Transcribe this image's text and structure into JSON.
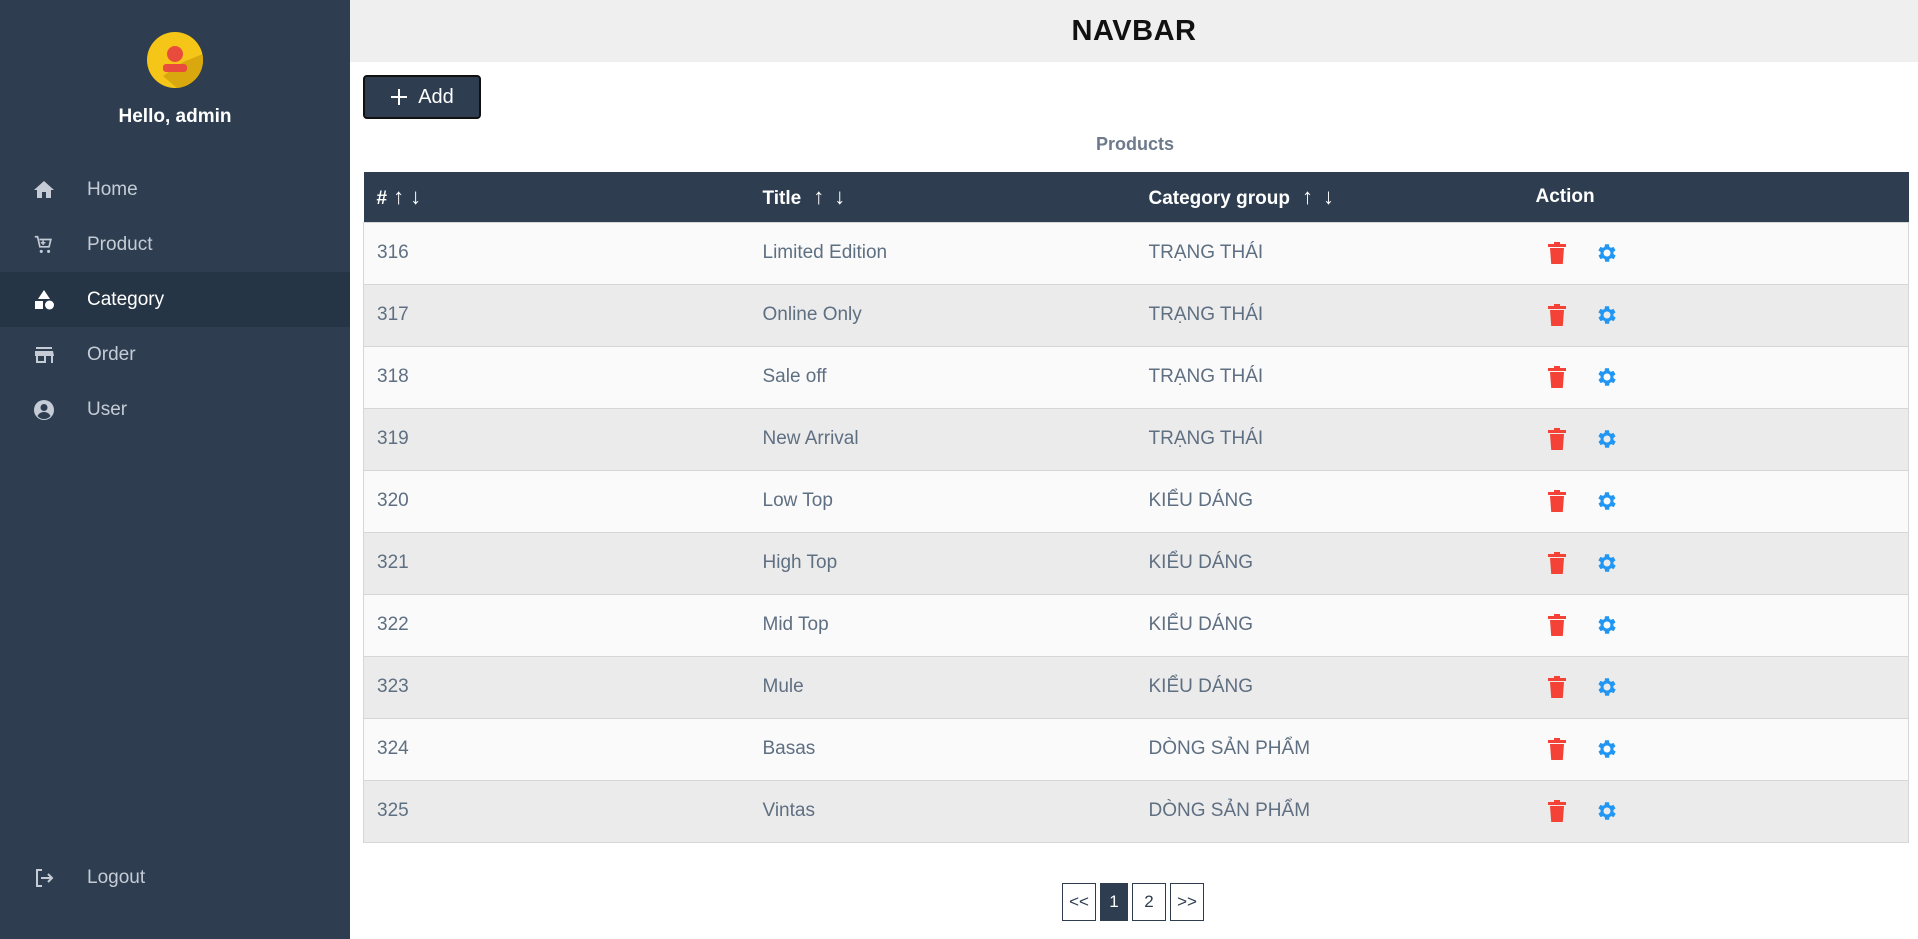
{
  "sidebar": {
    "greeting": "Hello, admin",
    "items": [
      {
        "label": "Home",
        "icon": "home-icon"
      },
      {
        "label": "Product",
        "icon": "cart-icon"
      },
      {
        "label": "Category",
        "icon": "shapes-icon",
        "active": true
      },
      {
        "label": "Order",
        "icon": "store-icon"
      },
      {
        "label": "User",
        "icon": "user-circle-icon"
      }
    ],
    "logout_label": "Logout"
  },
  "header": {
    "title": "NAVBAR"
  },
  "toolbar": {
    "add_label": "Add"
  },
  "table": {
    "caption": "Products",
    "columns": [
      "#",
      "Title",
      "Category group",
      "Action"
    ],
    "sort_up": "↑",
    "sort_down": "↓",
    "rows": [
      {
        "id": "316",
        "title": "Limited Edition",
        "group": "TRẠNG THÁI"
      },
      {
        "id": "317",
        "title": "Online Only",
        "group": "TRẠNG THÁI"
      },
      {
        "id": "318",
        "title": "Sale off",
        "group": "TRẠNG THÁI"
      },
      {
        "id": "319",
        "title": "New Arrival",
        "group": "TRẠNG THÁI"
      },
      {
        "id": "320",
        "title": "Low Top",
        "group": "KIỂU DÁNG"
      },
      {
        "id": "321",
        "title": "High Top",
        "group": "KIỂU DÁNG"
      },
      {
        "id": "322",
        "title": "Mid Top",
        "group": "KIỂU DÁNG"
      },
      {
        "id": "323",
        "title": "Mule",
        "group": "KIỂU DÁNG"
      },
      {
        "id": "324",
        "title": "Basas",
        "group": "DÒNG SẢN PHẨM"
      },
      {
        "id": "325",
        "title": "Vintas",
        "group": "DÒNG SẢN PHẨM"
      }
    ]
  },
  "pagination": {
    "prev": "<<",
    "pages": [
      "1",
      "2"
    ],
    "current": "1",
    "next": ">>"
  },
  "colors": {
    "sidebar_bg": "#2e3e50",
    "delete": "#f44336",
    "settings": "#2196f3",
    "avatar": "#f5c518"
  }
}
